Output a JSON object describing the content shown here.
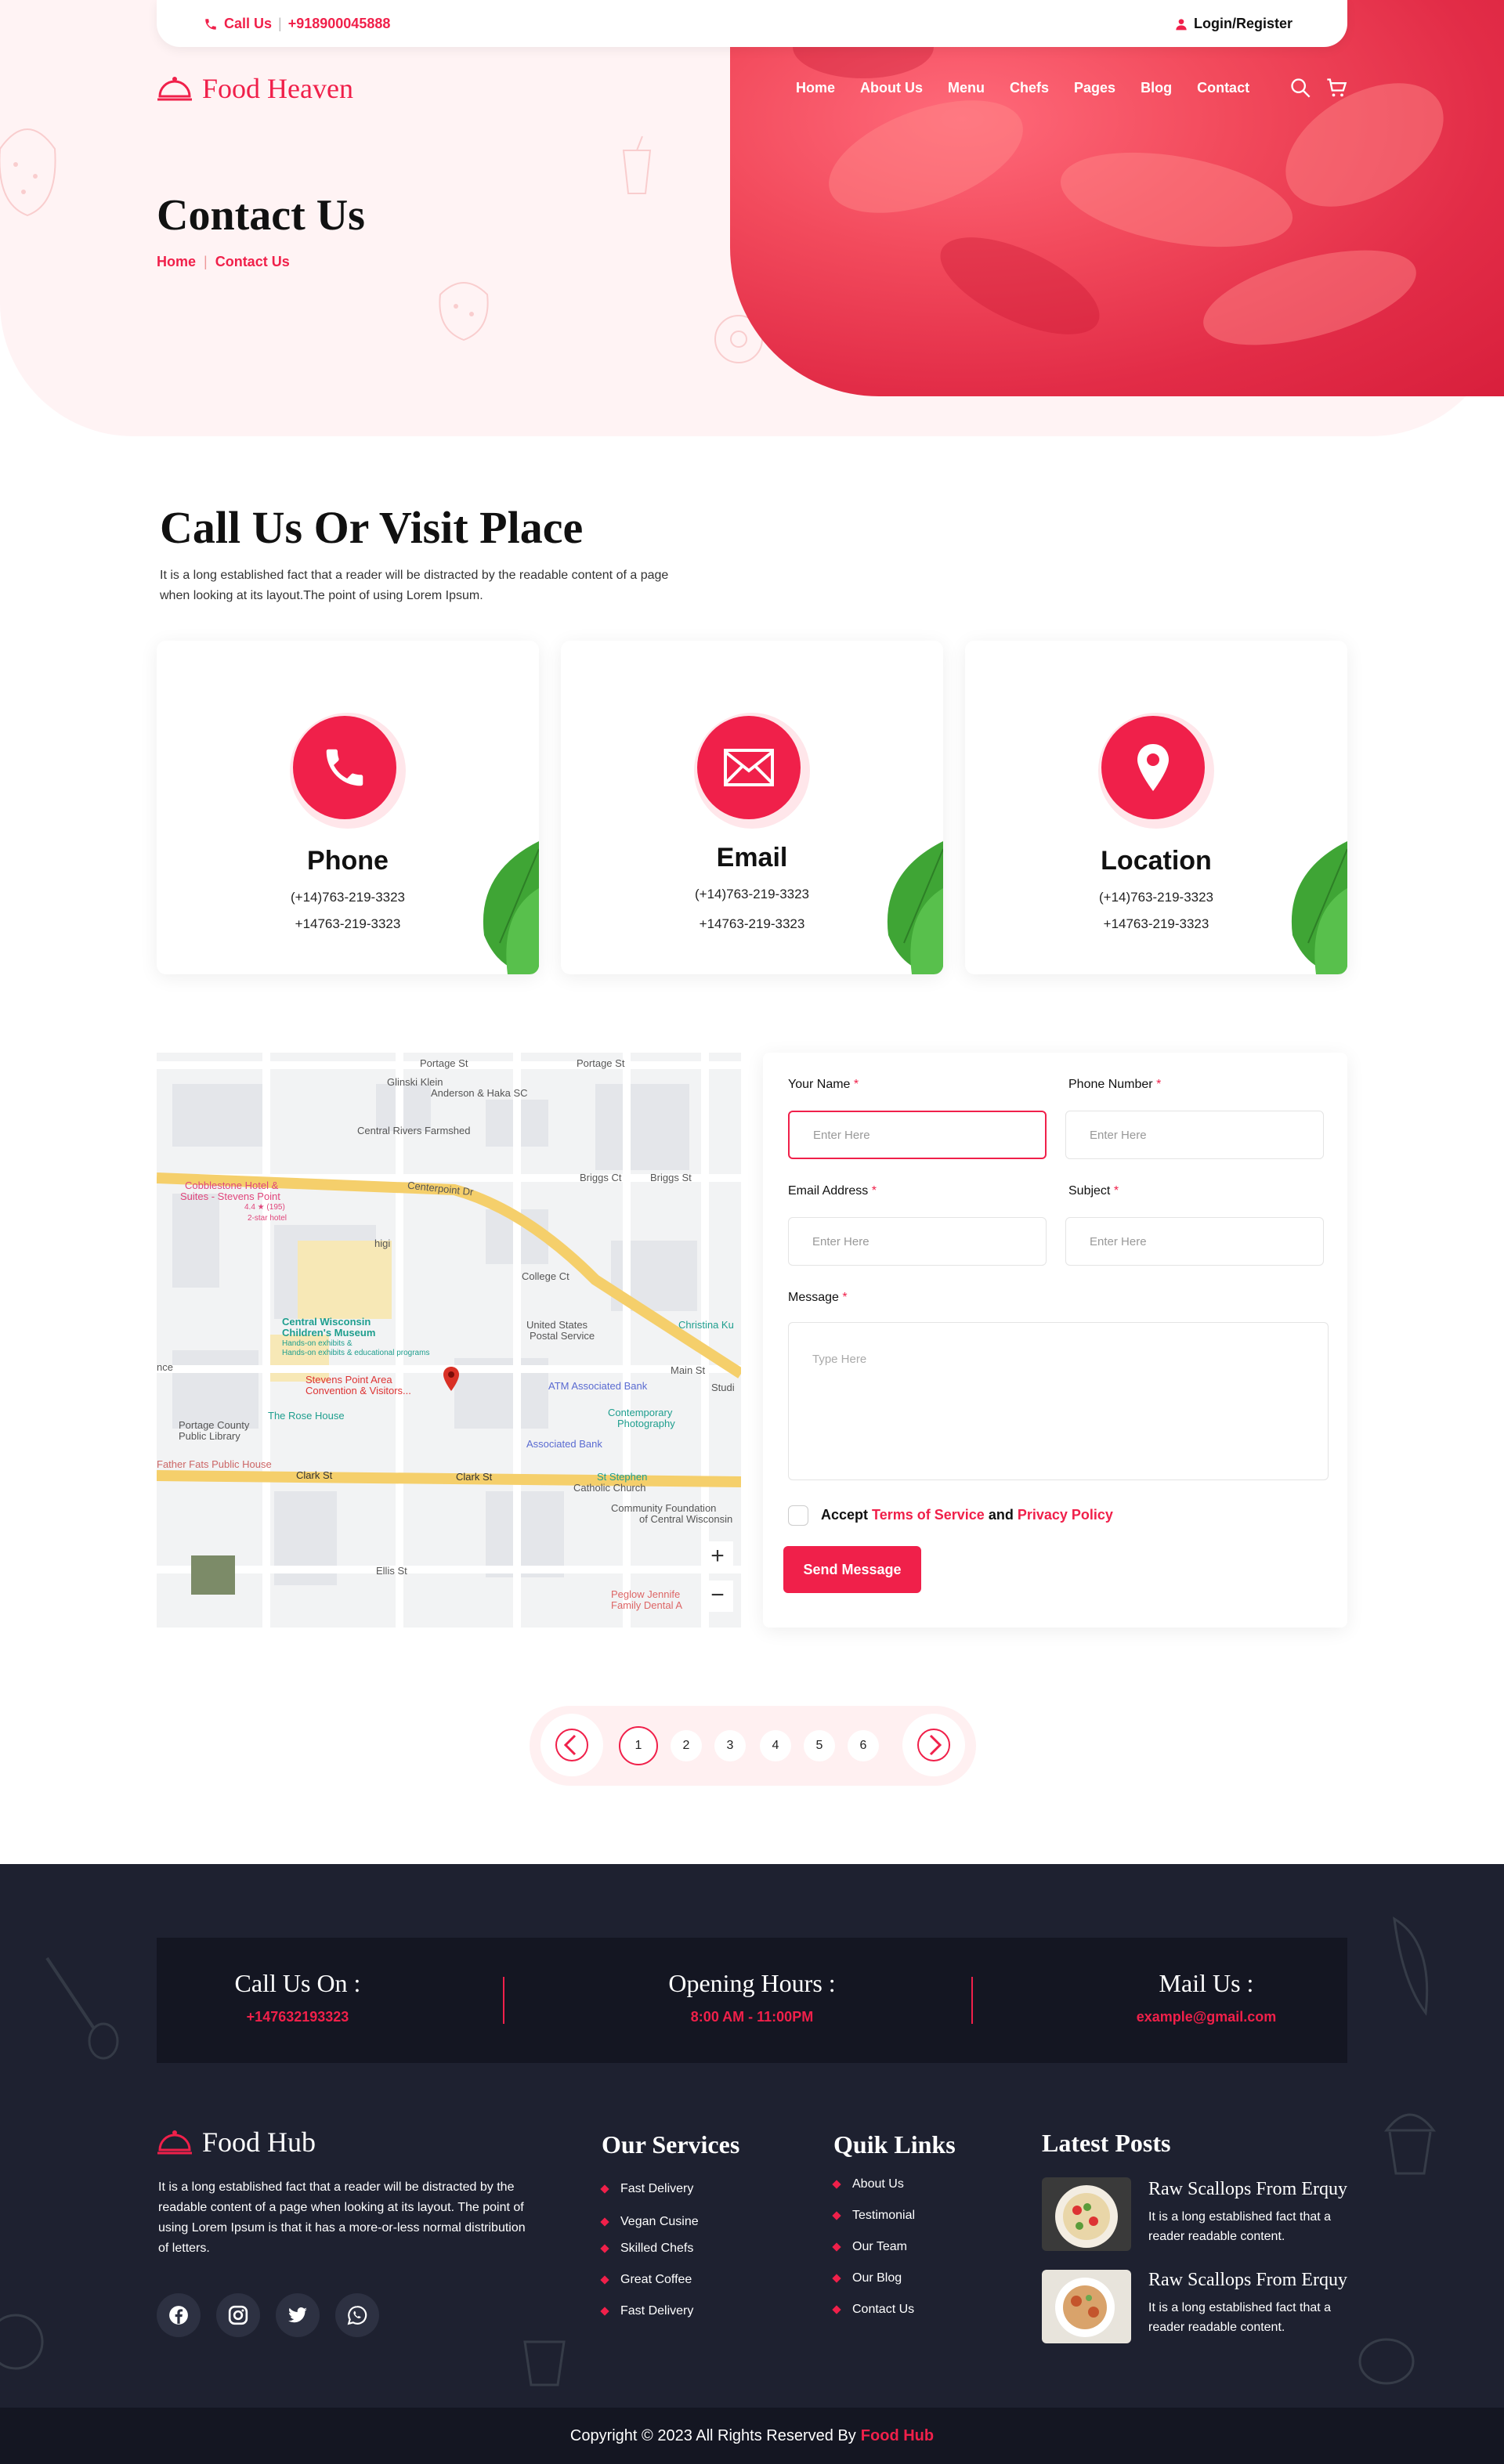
{
  "topbar": {
    "call_label": "Call Us",
    "phone": "+918900045888",
    "login": "Login/Register"
  },
  "brand": {
    "name": "Food Heaven"
  },
  "nav": [
    "Home",
    "About Us",
    "Menu",
    "Chefs",
    "Pages",
    "Blog",
    "Contact"
  ],
  "hero": {
    "title": "Contact Us",
    "breadcrumb": [
      "Home",
      "Contact Us"
    ]
  },
  "intro": {
    "title": "Call Us Or Visit Place",
    "desc": "It is a long established fact that a reader will be distracted by the readable content of a page when looking at its layout.The point of using Lorem Ipsum."
  },
  "cards": [
    {
      "title": "Phone",
      "line1": "(+14)763-219-3323",
      "line2": "+14763-219-3323",
      "icon": "phone-icon"
    },
    {
      "title": "Email",
      "line1": "(+14)763-219-3323",
      "line2": "+14763-219-3323",
      "icon": "mail-icon"
    },
    {
      "title": "Location",
      "line1": "(+14)763-219-3323",
      "line2": "+14763-219-3323",
      "icon": "location-pin-icon"
    }
  ],
  "map": {
    "labels": {
      "portage1": "Portage St",
      "portage2": "Portage St",
      "glinski": "Glinski Klein",
      "glinski2": "Anderson & Haka SC",
      "central": "Central Rivers Farmshed",
      "cobblestone": "Cobblestone Hotel &",
      "cobblestone2": "Suites - Stevens Point",
      "rating": "4.4 ★ (195)",
      "hotel": "2-star hotel",
      "centerpoint": "Centerpoint Dr",
      "briggs1": "Briggs Ct",
      "briggs2": "Briggs St",
      "college": "College Ct",
      "usps": "United States",
      "usps2": "Postal Service",
      "christina": "Christina Ku",
      "museum": "Central Wisconsin",
      "museum2": "Children's Museum",
      "museum3": "Hands-on exhibits &",
      "museum4": "Hands-on exhibits & educational programs",
      "visitor": "Stevens Point Area",
      "visitor2": "Convention & Visitors...",
      "atm": "ATM Associated Bank",
      "mainst": "Main St",
      "studio": "Studi",
      "library": "Portage County",
      "library2": "Public Library",
      "rose": "The Rose House",
      "contemporary": "Contemporary",
      "contemporary2": "Photography",
      "assoc": "Associated Bank",
      "fatpubs": "Father Fats Public House",
      "clark1": "Clark St",
      "clark2": "Clark St",
      "stephen": "St Stephen",
      "stephen2": "Catholic Church",
      "community": "Community Foundation",
      "community2": "of Central Wisconsin",
      "ellis": "Ellis St",
      "peglow": "Peglow Jennife",
      "peglow2": "Family Dental A",
      "higi": "higi",
      "nce": "nce",
      "zoom_in": "+",
      "zoom_out": "−"
    }
  },
  "form": {
    "name_label": "Your Name",
    "phone_label": "Phone Number",
    "email_label": "Email Address",
    "subject_label": "Subject",
    "message_label": "Message",
    "required_mark": "*",
    "placeholder": "Enter Here",
    "message_placeholder": "Type Here",
    "accept_prefix": "Accept",
    "terms": "Terms of Service",
    "and": "and",
    "privacy": "Privacy Policy",
    "submit": "Send Message"
  },
  "pagination": {
    "pages": [
      "1",
      "2",
      "3",
      "4",
      "5",
      "6"
    ],
    "current": "1"
  },
  "footer": {
    "info": [
      {
        "title": "Call Us On :",
        "value": "+147632193323"
      },
      {
        "title": "Opening Hours :",
        "value": "8:00 AM - 11:00PM"
      },
      {
        "title": "Mail Us :",
        "value": "example@gmail.com"
      }
    ],
    "brand": "Food Hub",
    "desc": "It is a long established fact that a reader will be distracted by the readable content of a page when looking at its layout. The point of using Lorem Ipsum is that it has a more-or-less normal distribution of letters.",
    "services_title": "Our Services",
    "services": [
      "Fast Delivery",
      "Vegan Cusine",
      "Skilled Chefs",
      "Great Coffee",
      "Fast Delivery"
    ],
    "links_title": "Quik Links",
    "links": [
      "About Us",
      "Testimonial",
      "Our Team",
      "Our Blog",
      "Contact Us"
    ],
    "posts_title": "Latest Posts",
    "posts": [
      {
        "title": "Raw Scallops From Erquy",
        "text": "It is a long established fact that a reader readable content."
      },
      {
        "title": "Raw Scallops From Erquy",
        "text": "It is a long established fact that a reader readable content."
      }
    ],
    "copyright": "Copyright © 2023 All Rights Reserved By",
    "copyright_brand": "Food Hub"
  },
  "colors": {
    "accent": "#f0204a",
    "footer_bg": "#1e2130",
    "footer_band": "#141622",
    "hero_bg": "#fff3f4"
  }
}
